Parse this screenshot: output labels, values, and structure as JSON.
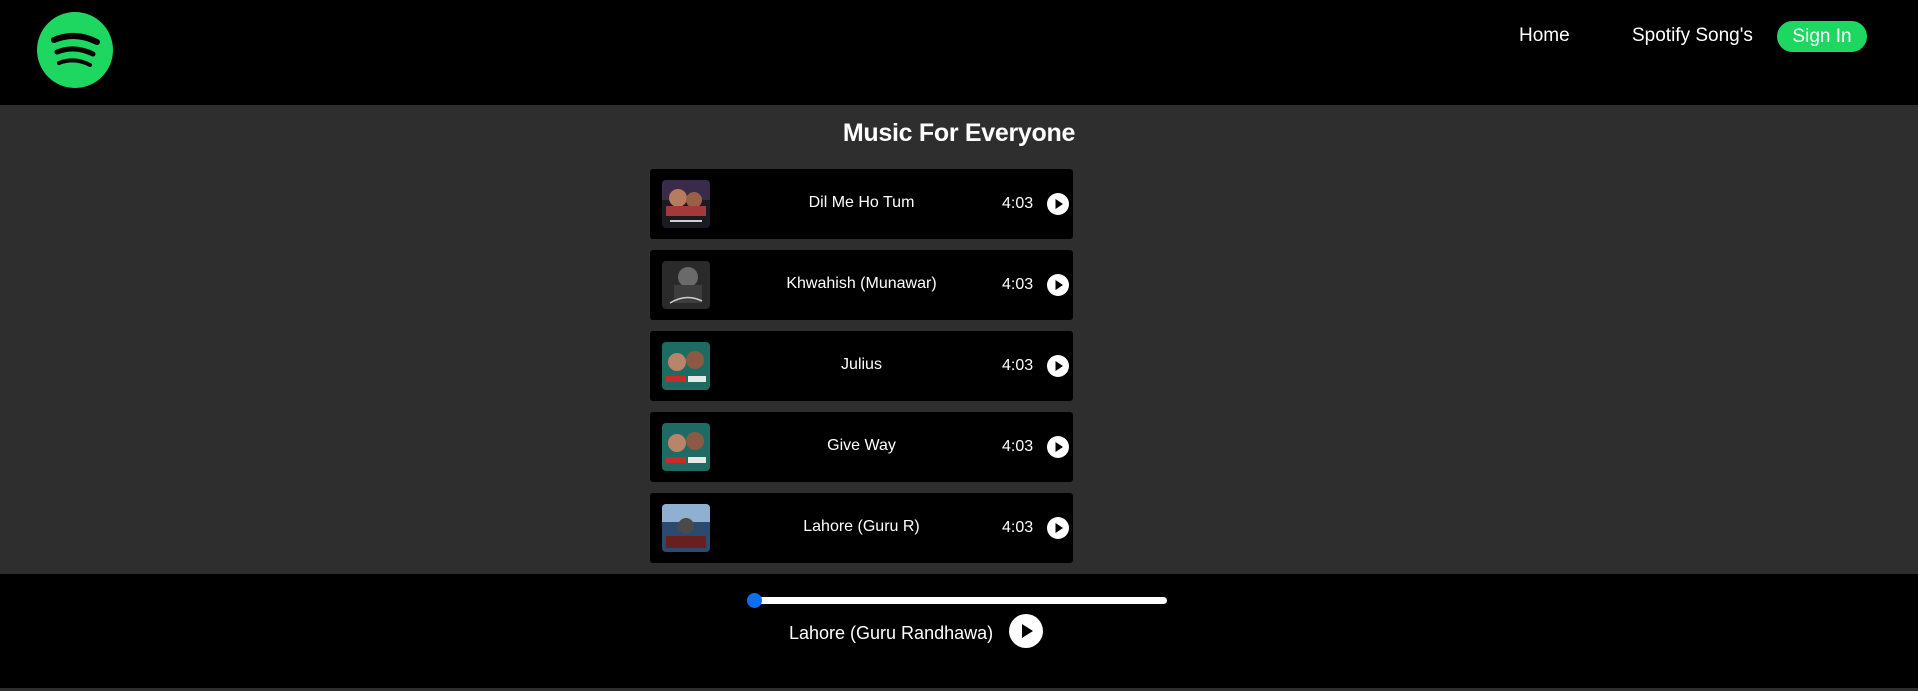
{
  "nav": {
    "logo_icon": "spotify-logo-icon",
    "links": [
      "Home",
      "Spotify Song's"
    ],
    "signin_label": "Sign In",
    "accent": "#1ed760"
  },
  "main": {
    "title": "Music For Everyone",
    "songs": [
      {
        "name": "Dil Me Ho Tum",
        "duration": "4:03",
        "icon": "play-circle-icon",
        "cover_palette": [
          "#3a2b4a",
          "#a33a3a",
          "#1a1a22"
        ]
      },
      {
        "name": "Khwahish (Munawar)",
        "duration": "4:03",
        "icon": "play-circle-icon",
        "cover_palette": [
          "#2a2a2a",
          "#6a6a6a",
          "#d0d0d0"
        ]
      },
      {
        "name": "Julius",
        "duration": "4:03",
        "icon": "play-circle-icon",
        "cover_palette": [
          "#1e6b63",
          "#b9846a",
          "#c92a2a"
        ]
      },
      {
        "name": "Give Way",
        "duration": "4:03",
        "icon": "play-circle-icon",
        "cover_palette": [
          "#1e6b63",
          "#b9846a",
          "#c92a2a"
        ]
      },
      {
        "name": "Lahore (Guru R)",
        "duration": "4:03",
        "icon": "play-circle-icon",
        "cover_palette": [
          "#2c4a6e",
          "#8fb0d0",
          "#6a1f1f"
        ]
      }
    ]
  },
  "player": {
    "now_playing": "Lahore (Guru Randhawa)",
    "progress": 0,
    "progress_color": "#0a6ff0",
    "icon": "play-circle-icon"
  }
}
